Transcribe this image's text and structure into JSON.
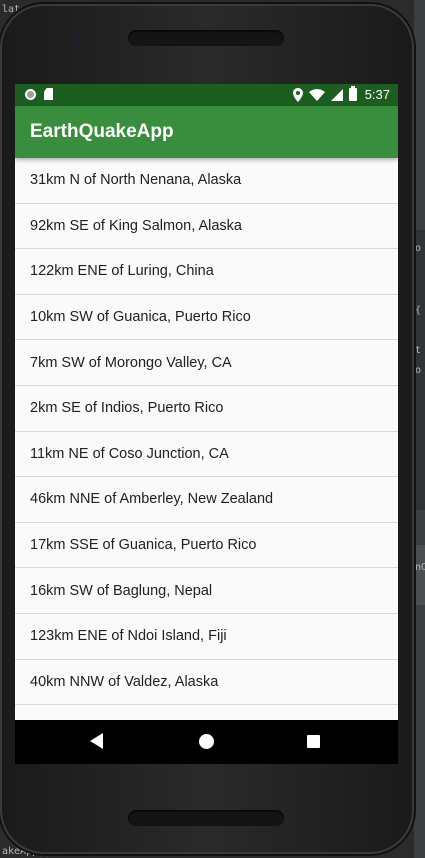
{
  "ide": {
    "top_left_text": "lat",
    "bottom_left_text": "akeApp||",
    "right_snippets": [
      "o",
      "{",
      "t",
      "o",
      "nO"
    ]
  },
  "status_bar": {
    "time": "5:37"
  },
  "app": {
    "title": "EarthQuakeApp"
  },
  "earthquakes": [
    "31km N of North Nenana, Alaska",
    "92km SE of King Salmon, Alaska",
    "122km ENE of Luring, China",
    "10km SW of Guanica, Puerto Rico",
    "7km SW of Morongo Valley, CA",
    "2km SE of Indios, Puerto Rico",
    "11km NE of Coso Junction, CA",
    "46km NNE of Amberley, New Zealand",
    "17km SSE of Guanica, Puerto Rico",
    "16km SW of Baglung, Nepal",
    "123km ENE of Ndoi Island, Fiji",
    "40km NNW of Valdez, Alaska"
  ],
  "colors": {
    "status_bar": "#1b5e20",
    "app_bar": "#388e3c",
    "list_background": "#fafafa"
  },
  "icons": {
    "status_left": [
      "notification-circle-icon",
      "sd-card-icon"
    ],
    "status_right": [
      "location-icon",
      "wifi-icon",
      "signal-icon",
      "battery-icon"
    ],
    "nav": [
      "back-icon",
      "home-icon",
      "recents-icon"
    ]
  }
}
